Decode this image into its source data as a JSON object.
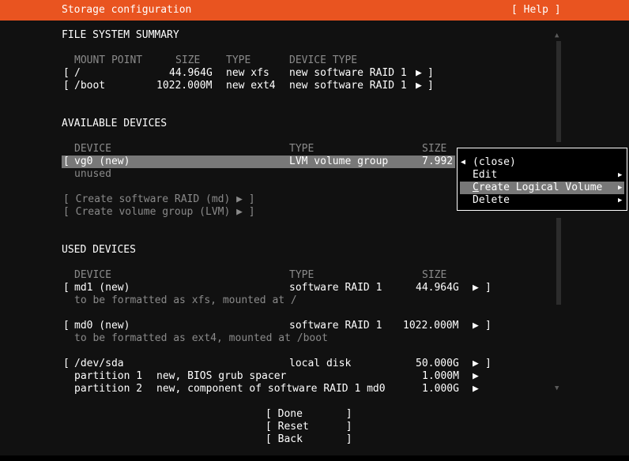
{
  "header": {
    "title": "Storage configuration",
    "help_label": "[ Help ]"
  },
  "fs_summary": {
    "heading": "FILE SYSTEM SUMMARY",
    "col_headers": [
      "MOUNT POINT",
      "SIZE",
      "TYPE",
      "DEVICE TYPE"
    ],
    "rows": [
      {
        "bracket_open": "[",
        "mount": "/",
        "size": "44.964G",
        "type": "new xfs",
        "device_type": "new software RAID 1",
        "arrow": "▶",
        "bracket_close": "]"
      },
      {
        "bracket_open": "[",
        "mount": "/boot",
        "size": "1022.000M",
        "type": "new ext4",
        "device_type": "new software RAID 1",
        "arrow": "▶",
        "bracket_close": "]"
      }
    ]
  },
  "available": {
    "heading": "AVAILABLE DEVICES",
    "col_headers": [
      "DEVICE",
      "TYPE",
      "SIZE"
    ],
    "selected_row": {
      "bracket_open": "[",
      "device": "vg0 (new)",
      "type": "LVM volume group",
      "size": "7.992"
    },
    "sub_note": "unused",
    "actions": [
      "[ Create software RAID (md) ▶ ]",
      "[ Create volume group (LVM) ▶ ]"
    ]
  },
  "used": {
    "heading": "USED DEVICES",
    "col_headers": [
      "DEVICE",
      "TYPE",
      "SIZE"
    ],
    "devices": [
      {
        "bracket_open": "[",
        "device": "md1 (new)",
        "type": "software RAID 1",
        "size": "44.964G",
        "arrow": "▶",
        "bracket_close": "]",
        "note": "to be formatted as xfs, mounted at /"
      },
      {
        "bracket_open": "[",
        "device": "md0 (new)",
        "type": "software RAID 1",
        "size": "1022.000M",
        "arrow": "▶",
        "bracket_close": "]",
        "note": "to be formatted as ext4, mounted at /boot"
      },
      {
        "bracket_open": "[",
        "device": "/dev/sda",
        "type": "local disk",
        "size": "50.000G",
        "arrow": "▶",
        "bracket_close": "]"
      }
    ],
    "partitions": [
      {
        "label": "partition 1",
        "desc": "new, BIOS grub spacer",
        "size": "1.000M",
        "arrow": "▶"
      },
      {
        "label": "partition 2",
        "desc": "new, component of software RAID 1 md0",
        "size": "1.000G",
        "arrow": "▶"
      }
    ]
  },
  "popup": {
    "close_arrow": "◀",
    "items": [
      {
        "label": "(close)",
        "arrow": ""
      },
      {
        "label": "Edit",
        "arrow": "▶"
      },
      {
        "label_first": "C",
        "label_rest": "reate Logical Volume",
        "arrow": "▶"
      },
      {
        "label": "Delete",
        "arrow": "▶"
      }
    ]
  },
  "scrollbar": {
    "up_arrow": "▲",
    "down_arrow": "▼"
  },
  "footer": {
    "done": "[ Done       ]",
    "reset": "[ Reset      ]",
    "back": "[ Back       ]"
  },
  "colors": {
    "header": "#e95420",
    "background": "#111111",
    "selection": "#787878"
  }
}
